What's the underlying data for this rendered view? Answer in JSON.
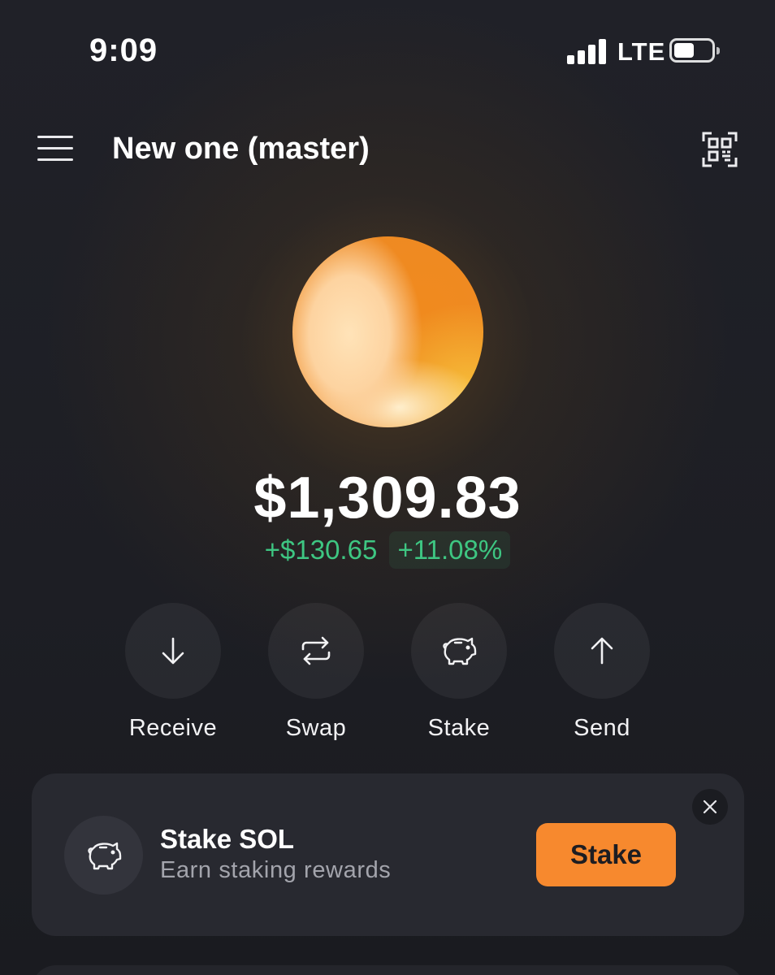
{
  "status_bar": {
    "time": "9:09",
    "network": "LTE"
  },
  "header": {
    "wallet_name": "New one (master)",
    "menu_icon": "hamburger-menu-icon",
    "qr_icon": "qr-scan-icon"
  },
  "portfolio": {
    "balance": "$1,309.83",
    "change_amount": "+$130.65",
    "change_percent": "+11.08%"
  },
  "actions": [
    {
      "label": "Receive",
      "icon": "arrow-down-icon"
    },
    {
      "label": "Swap",
      "icon": "swap-arrows-icon"
    },
    {
      "label": "Stake",
      "icon": "piggy-bank-icon"
    },
    {
      "label": "Send",
      "icon": "arrow-up-icon"
    }
  ],
  "stake_card": {
    "title": "Stake SOL",
    "subtitle": "Earn staking rewards",
    "button_label": "Stake",
    "icon": "piggy-bank-icon",
    "close_icon": "close-icon"
  },
  "colors": {
    "background": "#1c1d22",
    "positive": "#3ec682",
    "accent": "#f7892e",
    "card": "#282930"
  }
}
